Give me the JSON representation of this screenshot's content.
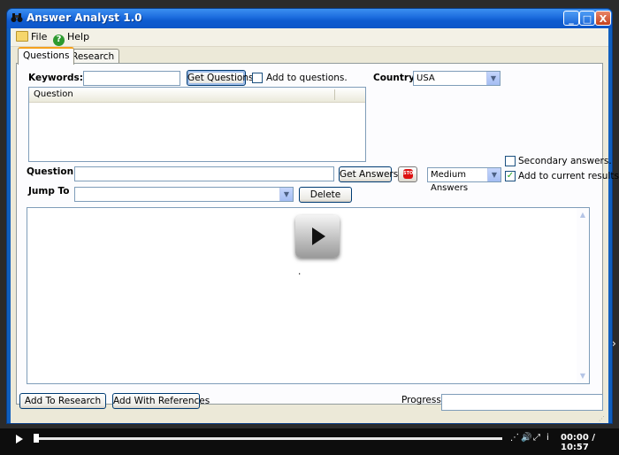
{
  "window": {
    "title": "Answer Analyst 1.0",
    "icon": "binoculars-icon",
    "controls": {
      "minimize": "_",
      "maximize": "□",
      "close": "X"
    }
  },
  "menu": {
    "file": "File",
    "help": "Help",
    "help_icon_glyph": "?"
  },
  "tabs": [
    {
      "label": "Questions",
      "active": true
    },
    {
      "label": "Research",
      "active": false
    }
  ],
  "questions_tab": {
    "keywords_label": "Keywords:",
    "keywords_value": "",
    "get_questions": "Get Questions",
    "add_to_questions": {
      "label": "Add to questions.",
      "checked": false
    },
    "country_label": "Country",
    "country_value": "USA",
    "question_list": {
      "columns": [
        "Question"
      ]
    },
    "secondary_answers": {
      "label": "Secondary answers.",
      "checked": false
    },
    "add_to_current": {
      "label": "Add to current results.",
      "checked": true,
      "mark": "✓"
    },
    "question_label": "Question",
    "question_value": "",
    "get_answers": "Get Answers",
    "stop_icon_text": "STOP",
    "answer_mode": "Medium Answers",
    "jump_to_label": "Jump To",
    "jump_to_value": "",
    "delete": "Delete",
    "results_text": "."
  },
  "bottom": {
    "add_to_research": "Add To Research",
    "add_with_references": "Add With References",
    "progress_label": "Progress:",
    "progress_value": 0
  },
  "player": {
    "time": "00:00 / 10:57"
  },
  "colors": {
    "titlebar": "#0c56c8",
    "panel": "#ece9d8",
    "tab_highlight": "#f5a11c",
    "check": "#21a121"
  }
}
